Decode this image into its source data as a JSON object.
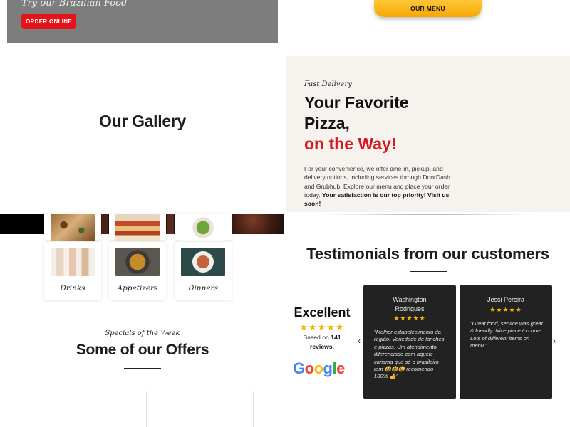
{
  "hero": {
    "script_text": "Try our Brazilian Food",
    "order_button": "ORDER ONLINE"
  },
  "top_menu": {
    "label": "OUR MENU"
  },
  "gallery": {
    "title": "Our Gallery"
  },
  "delivery": {
    "eyebrow": "Fast Delivery",
    "title_line1": "Your Favorite",
    "title_line2": "Pizza,",
    "title_line3": "on the Way!",
    "body_plain": "For your convenience, we offer dine-in, pickup, and delivery options, including services through DoorDash and Grubhub. Explore our menu and place your order today. ",
    "body_bold": "Your satisfaction is our top priority! Visit us soon!"
  },
  "menu_cards": [
    {
      "label": "Drinks",
      "image": "drinks-photo"
    },
    {
      "label": "Appetizers",
      "image": "appetizers-photo"
    },
    {
      "label": "Dinners",
      "image": "dinners-photo"
    }
  ],
  "specials": {
    "eyebrow": "Specials of the Week",
    "title": "Some of our Offers"
  },
  "testimonials": {
    "title": "Testimonials from our customers",
    "rating_word": "Excellent",
    "stars": "★★★★★",
    "based_prefix": "Based on ",
    "review_count": "141",
    "based_suffix": "reviews.",
    "google_logo": [
      "G",
      "o",
      "o",
      "g",
      "l",
      "e"
    ],
    "prev_arrow": "‹",
    "next_arrow": "›",
    "reviews": [
      {
        "name": "Washington Rodrigues",
        "stars": "★★★★★",
        "text": "\"Melhor estabelecimento da região! Variedade de lanches e pizzas. Um atendimento diferenciado com aquele carisma que só o brasileiro tem 😃😃😃 recomendo 100% 👍\""
      },
      {
        "name": "Jessi Pereira",
        "stars": "★★★★★",
        "text": "\"Great food, service was great & friendly. Nice place to come. Lots of different items on menu.\""
      }
    ]
  }
}
